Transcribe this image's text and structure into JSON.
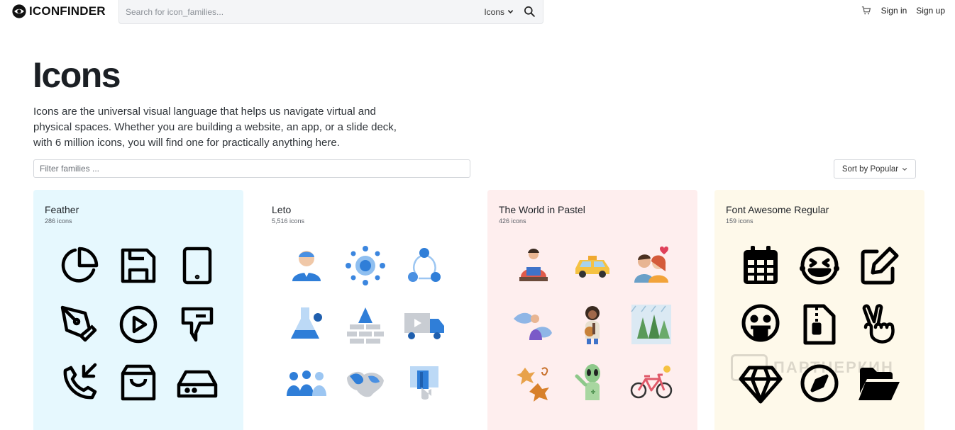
{
  "brand": {
    "name": "ICONFINDER"
  },
  "search": {
    "placeholder": "Search for icon_families...",
    "type_label": "Icons"
  },
  "nav": {
    "sign_in": "Sign in",
    "sign_up": "Sign up"
  },
  "page": {
    "title": "Icons",
    "description": "Icons are the universal visual language that helps us navigate virtual and physical spaces. Whether you are building a website, an app, or a slide deck, with 6 million icons, you will find one for practically anything here."
  },
  "filter": {
    "placeholder": "Filter families ..."
  },
  "sort": {
    "label": "Sort by Popular"
  },
  "watermark": {
    "text": "ПАРТНЕРКИН"
  },
  "colors": {
    "feather_bg": "#e6f8fe",
    "leto_bg": "#ffffff",
    "pastel_bg": "#feeeee",
    "fontawesome_bg": "#fef9ea",
    "accent_blue": "#2f7ed8"
  },
  "families": [
    {
      "name": "Feather",
      "count": "286 icons",
      "icons": [
        "pie-chart-icon",
        "save-icon",
        "tablet-icon",
        "pen-tool-icon",
        "play-circle-icon",
        "figma-icon",
        "phone-incoming-icon",
        "shopping-bag-icon",
        "hard-drive-icon"
      ]
    },
    {
      "name": "Leto",
      "count": "5,516 icons",
      "icons": [
        "businessman-icon",
        "network-gear-icon",
        "cycle-flow-icon",
        "lab-flask-icon",
        "firewall-icon",
        "delivery-truck-icon",
        "team-icon",
        "world-map-icon",
        "card-payment-icon"
      ]
    },
    {
      "name": "The World in Pastel",
      "count": "426 icons",
      "icons": [
        "reading-couple-icon",
        "taxi-icon",
        "couple-love-icon",
        "fish-person-icon",
        "woman-guitar-icon",
        "rain-trees-icon",
        "autumn-leaves-icon",
        "alien-icon",
        "bicycle-icon"
      ]
    },
    {
      "name": "Font Awesome Regular",
      "count": "159 icons",
      "icons": [
        "calendar-icon",
        "laugh-squint-icon",
        "edit-icon",
        "grin-tongue-icon",
        "file-archive-icon",
        "hand-peace-icon",
        "gem-icon",
        "compass-icon",
        "folder-open-icon"
      ]
    }
  ]
}
